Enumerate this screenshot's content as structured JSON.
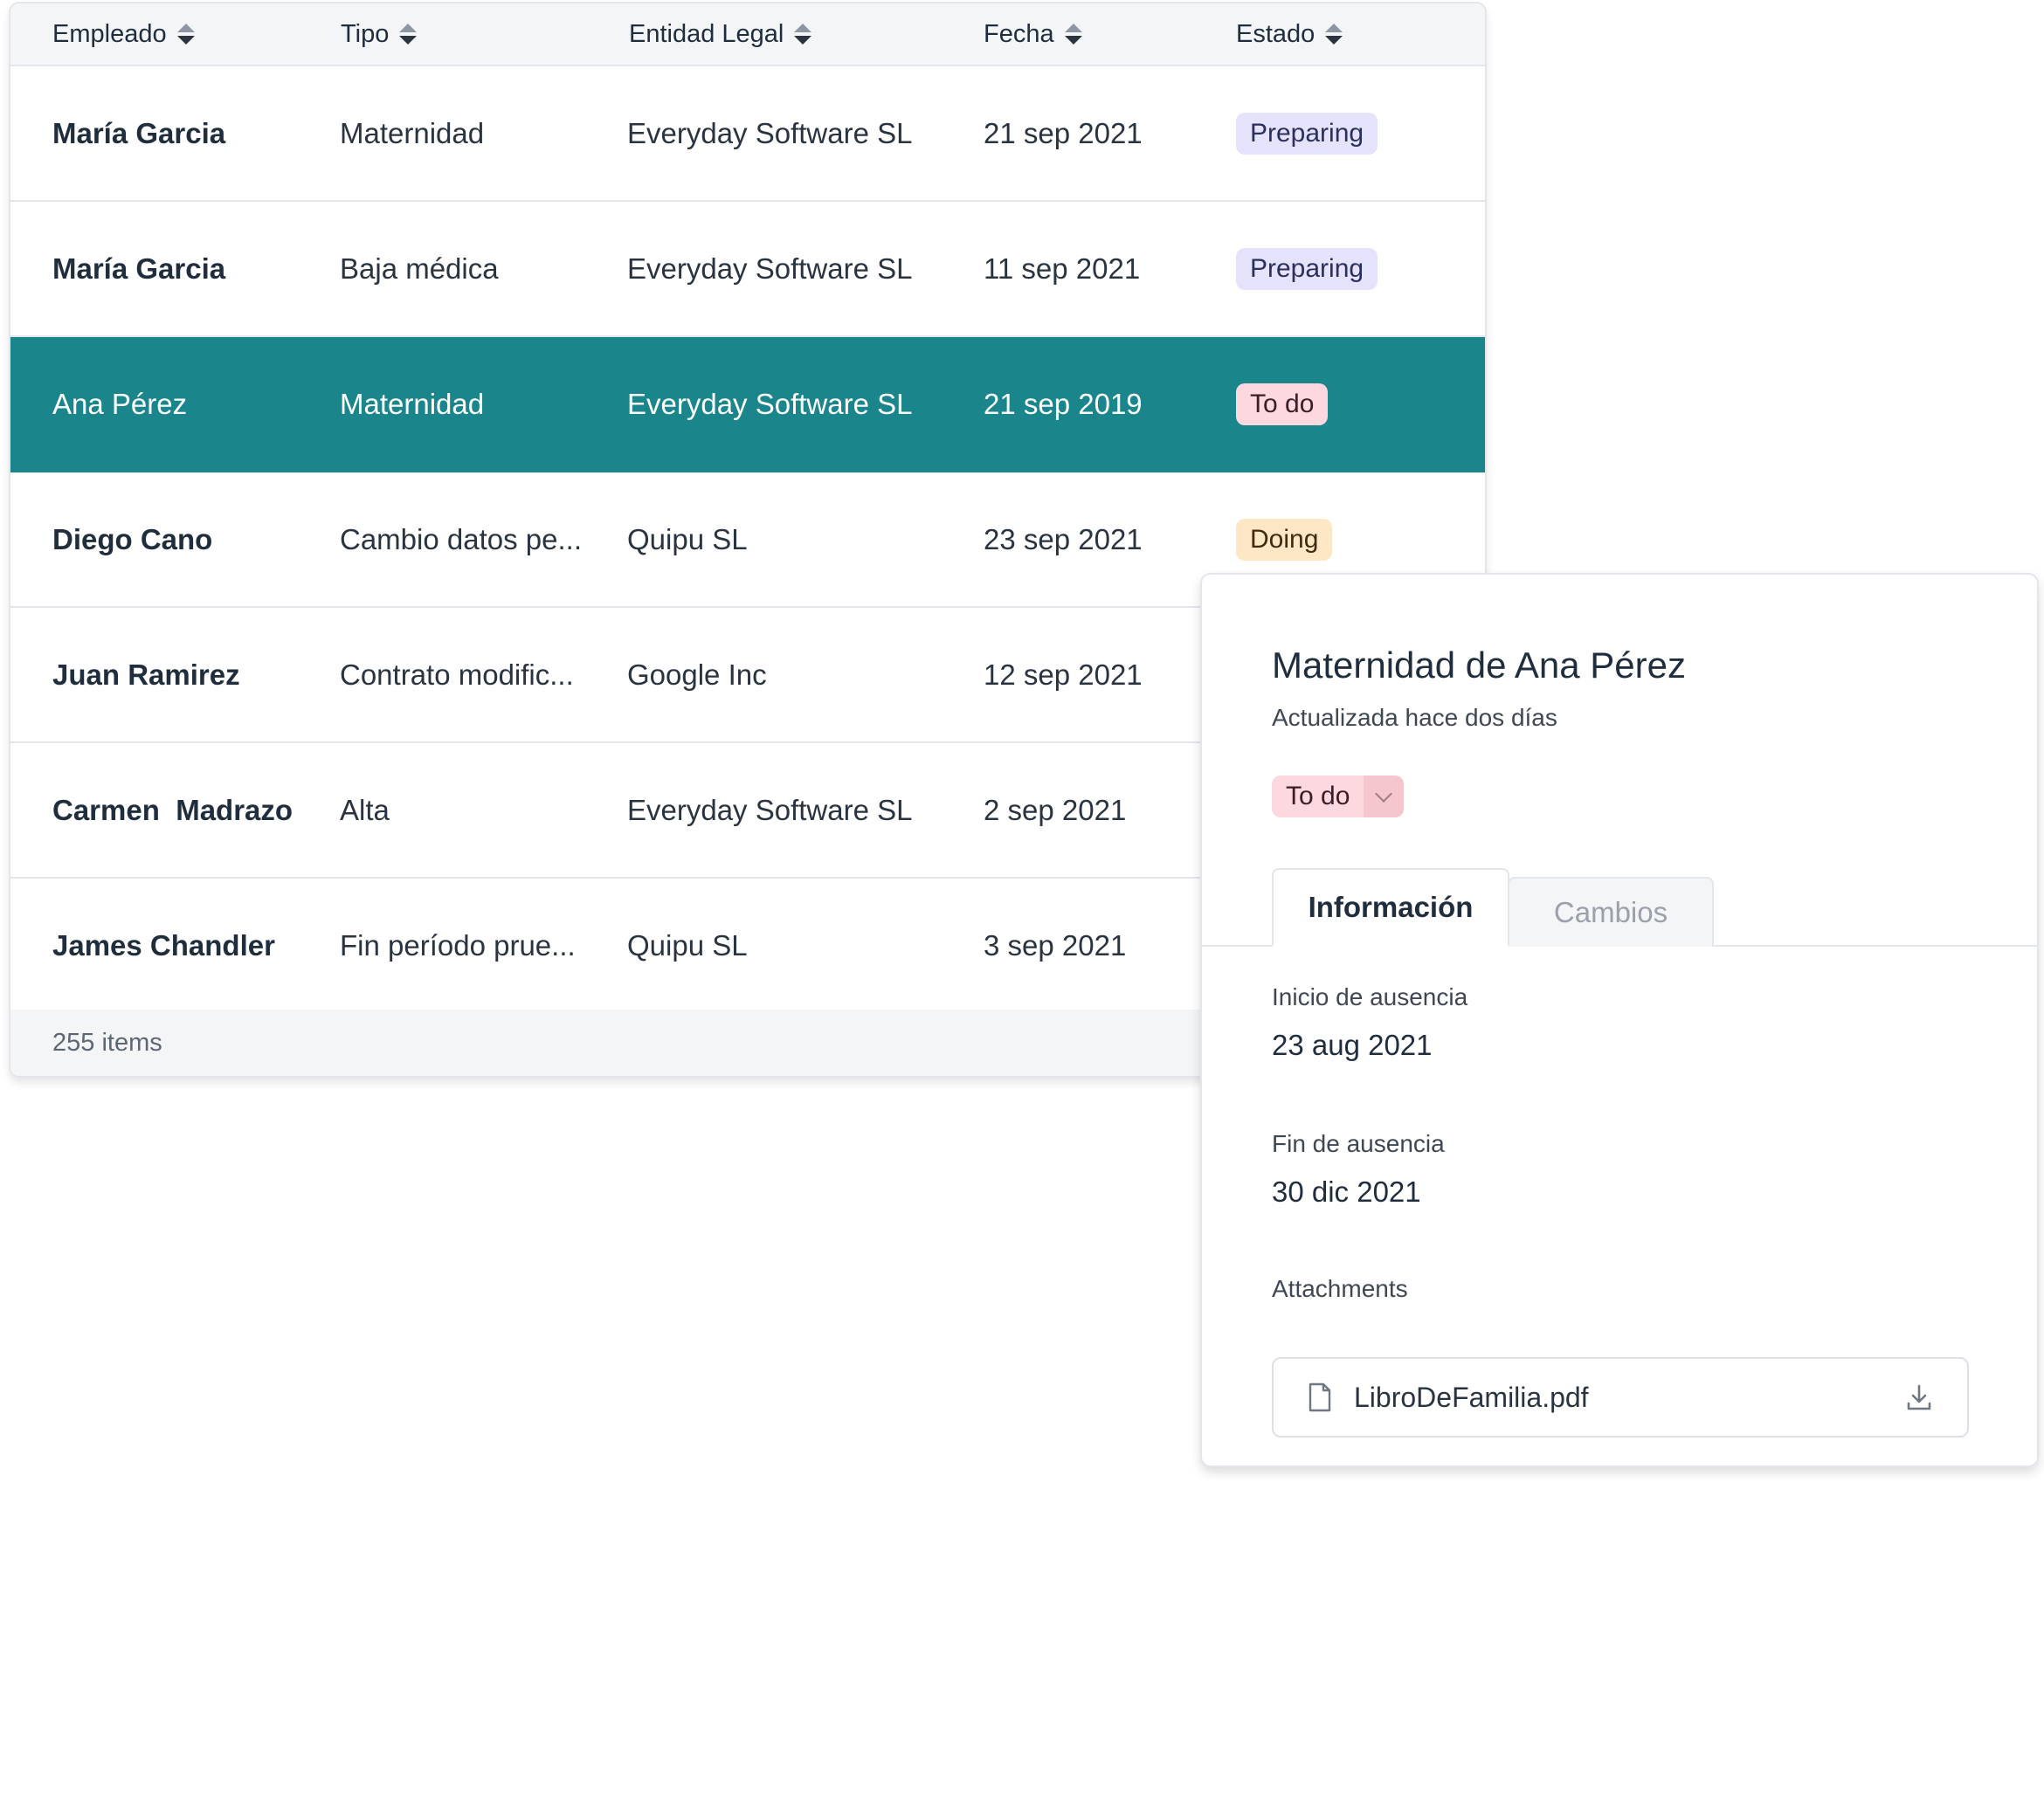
{
  "table": {
    "headers": {
      "empleado": "Empleado",
      "tipo": "Tipo",
      "entidad": "Entidad Legal",
      "fecha": "Fecha",
      "estado": "Estado"
    },
    "rows": [
      {
        "empleado": "María Garcia",
        "tipo": "Maternidad",
        "entidad": "Everyday Software SL",
        "fecha": "21 sep 2021",
        "estado": "Preparing"
      },
      {
        "empleado": "María Garcia",
        "tipo": "Baja médica",
        "entidad": "Everyday Software SL",
        "fecha": "11 sep 2021",
        "estado": "Preparing"
      },
      {
        "empleado": "Ana Pérez",
        "tipo": "Maternidad",
        "entidad": "Everyday Software SL",
        "fecha": "21 sep 2019",
        "estado": "To do"
      },
      {
        "empleado": "Diego Cano",
        "tipo": "Cambio datos pe...",
        "entidad": "Quipu SL",
        "fecha": "23 sep 2021",
        "estado": "Doing"
      },
      {
        "empleado": "Juan Ramirez",
        "tipo": "Contrato modific...",
        "entidad": "Google Inc",
        "fecha": "12 sep 2021",
        "estado": ""
      },
      {
        "empleado": "Carmen  Madrazo",
        "tipo": "Alta",
        "entidad": "Everyday Software SL",
        "fecha": "2 sep 2021",
        "estado": ""
      },
      {
        "empleado": "James Chandler",
        "tipo": "Fin período prue...",
        "entidad": "Quipu SL",
        "fecha": "3 sep 2021",
        "estado": ""
      }
    ],
    "footer": "255 items"
  },
  "detail": {
    "title": "Maternidad de Ana Pérez",
    "subtitle": "Actualizada hace dos días",
    "status": "To do",
    "tabs": {
      "info": "Información",
      "changes": "Cambios"
    },
    "inicio_label": "Inicio de ausencia",
    "inicio_value": "23 aug 2021",
    "fin_label": "Fin de ausencia",
    "fin_value": "30 dic 2021",
    "attachments_label": "Attachments",
    "attachment_file": "LibroDeFamilia.pdf"
  },
  "colors": {
    "selected_row": "#1a868c",
    "badge_preparing": "#e4e3fb",
    "badge_todo": "#fdd8de",
    "badge_doing": "#fde7c4"
  },
  "icons": {
    "sort": "sort-icon",
    "file": "file-icon",
    "download": "download-icon",
    "chevron": "chevron-down-icon"
  }
}
